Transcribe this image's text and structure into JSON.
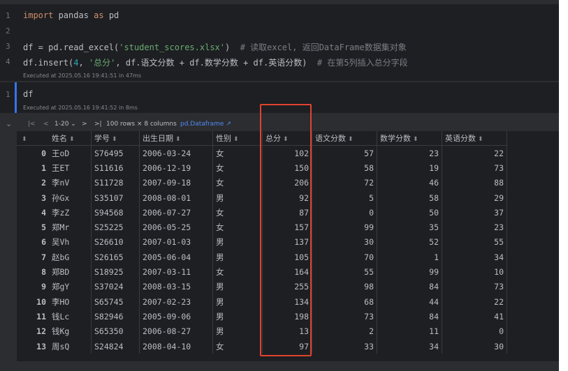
{
  "cells": [
    {
      "lines": [
        {
          "n": "1",
          "parts": [
            [
              "kw",
              "import"
            ],
            [
              "",
              " pandas "
            ],
            [
              "kw",
              "as"
            ],
            [
              "",
              " pd"
            ]
          ]
        },
        {
          "n": "2",
          "parts": []
        },
        {
          "n": "3",
          "parts": [
            [
              "",
              "df = pd.read_excel("
            ],
            [
              "str",
              "'student_scores.xlsx'"
            ],
            [
              "",
              ")  "
            ],
            [
              "cm",
              "# 读取excel, 返回DataFrame数据集对象"
            ]
          ]
        },
        {
          "n": "4",
          "parts": [
            [
              "",
              "df.insert("
            ],
            [
              "num",
              "4"
            ],
            [
              "",
              ", "
            ],
            [
              "str",
              "'总分'"
            ],
            [
              "",
              ", df.语文分数 + df.数学分数 + df.英语分数)  "
            ],
            [
              "cm",
              "# 在第5列插入总分字段"
            ]
          ]
        }
      ],
      "executed": "Executed at 2025.05.16 19:41:51 in 47ms"
    },
    {
      "lines": [
        {
          "n": "1",
          "parts": [
            [
              "",
              "df"
            ]
          ]
        }
      ],
      "executed": "Executed at 2025.05.16 19:41:52 in 8ms"
    }
  ],
  "output_toolbar": {
    "collapse": "⌄",
    "first": "|<",
    "prev": "<",
    "page_range": "1-20 ⌄",
    "next": ">",
    "last": ">|",
    "summary": "100 rows × 8 columns",
    "type_link": "pd.Dataframe ↗"
  },
  "table": {
    "columns": [
      "姓名",
      "学号",
      "出生日期",
      "性别",
      "总分",
      "语文分数",
      "数学分数",
      "英语分数"
    ],
    "rows": [
      [
        "0",
        "王oD",
        "S76495",
        "2006-03-24",
        "女",
        "102",
        "57",
        "23",
        "22"
      ],
      [
        "1",
        "王ET",
        "S11616",
        "2006-12-19",
        "女",
        "150",
        "58",
        "19",
        "73"
      ],
      [
        "2",
        "李nV",
        "S11728",
        "2007-09-18",
        "女",
        "206",
        "72",
        "46",
        "88"
      ],
      [
        "3",
        "孙Gx",
        "S35107",
        "2008-08-01",
        "男",
        "92",
        "5",
        "58",
        "29"
      ],
      [
        "4",
        "李zZ",
        "S94568",
        "2006-07-27",
        "女",
        "87",
        "0",
        "50",
        "37"
      ],
      [
        "5",
        "郑Mr",
        "S25225",
        "2006-05-25",
        "女",
        "157",
        "99",
        "35",
        "23"
      ],
      [
        "6",
        "吴Vh",
        "S26610",
        "2007-01-03",
        "男",
        "137",
        "30",
        "52",
        "55"
      ],
      [
        "7",
        "赵bG",
        "S26165",
        "2005-06-04",
        "男",
        "105",
        "70",
        "1",
        "34"
      ],
      [
        "8",
        "郑BD",
        "S18925",
        "2007-03-11",
        "女",
        "164",
        "55",
        "99",
        "10"
      ],
      [
        "9",
        "郑gY",
        "S37024",
        "2008-03-15",
        "男",
        "255",
        "98",
        "84",
        "73"
      ],
      [
        "10",
        "李HO",
        "S65745",
        "2007-02-23",
        "男",
        "134",
        "68",
        "44",
        "22"
      ],
      [
        "11",
        "钱Lc",
        "S82946",
        "2005-09-06",
        "男",
        "198",
        "73",
        "84",
        "41"
      ],
      [
        "12",
        "钱Kg",
        "S65350",
        "2006-08-27",
        "男",
        "13",
        "2",
        "11",
        "0"
      ],
      [
        "13",
        "周sQ",
        "S24824",
        "2008-04-10",
        "女",
        "97",
        "33",
        "34",
        "30"
      ]
    ]
  }
}
